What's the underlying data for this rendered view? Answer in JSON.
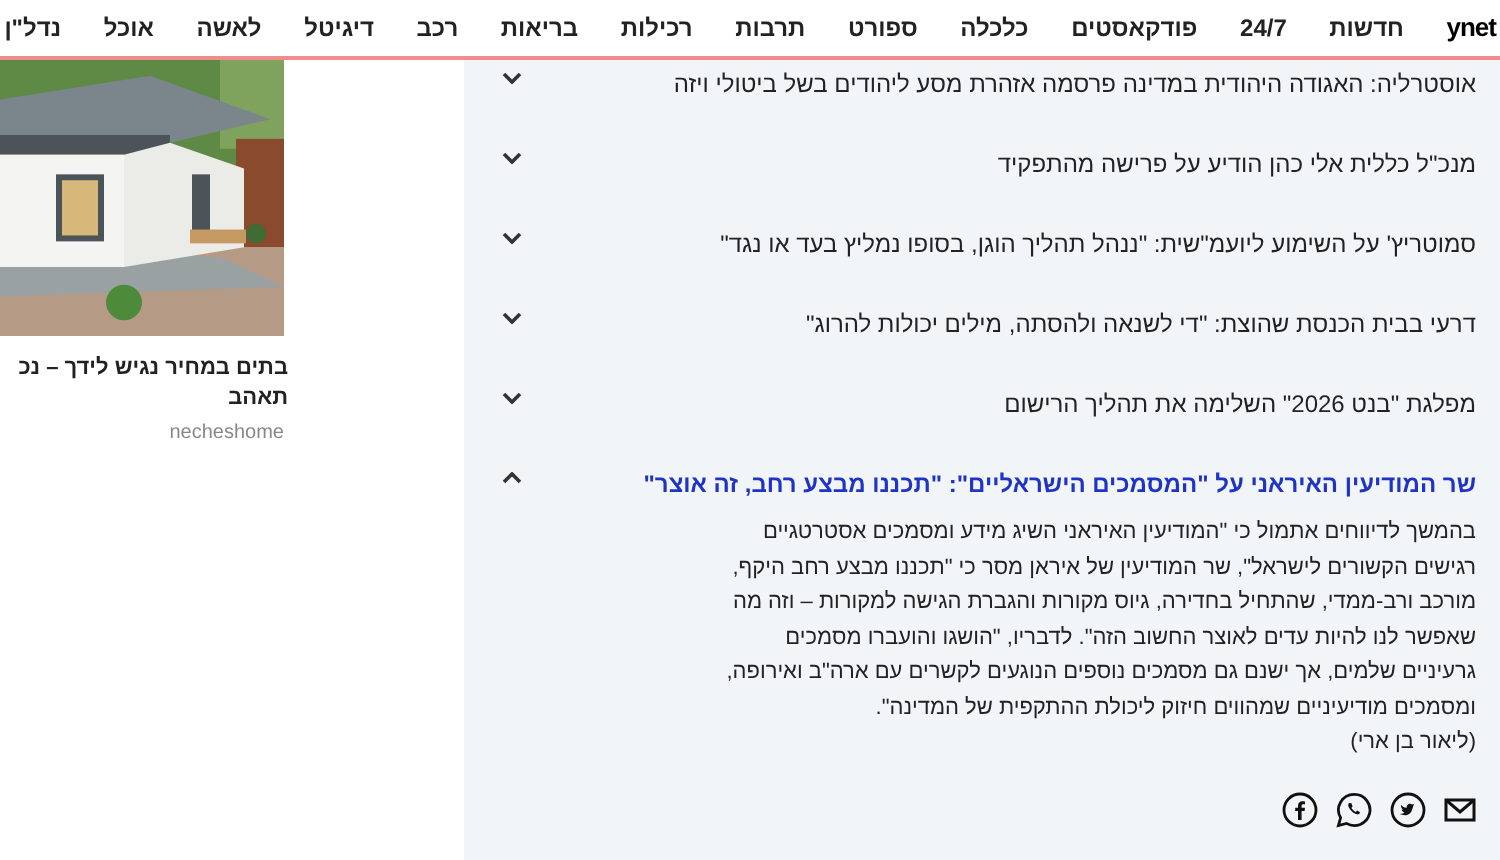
{
  "nav": {
    "items": [
      {
        "label": "ynet",
        "kind": "logo"
      },
      {
        "label": "חדשות"
      },
      {
        "label": "24/7"
      },
      {
        "label": "פודקאסטים"
      },
      {
        "label": "כלכלה"
      },
      {
        "label": "ספורט"
      },
      {
        "label": "תרבות"
      },
      {
        "label": "רכילות"
      },
      {
        "label": "בריאות"
      },
      {
        "label": "רכב"
      },
      {
        "label": "דיגיטל"
      },
      {
        "label": "לאשה"
      },
      {
        "label": "אוכל"
      },
      {
        "label": "נדל\"ן"
      }
    ]
  },
  "ad": {
    "title_lines": [
      "בתים במחיר נגיש לידך – נכ",
      "תאהב"
    ],
    "source": "necheshome"
  },
  "news": [
    {
      "headline": "אוסטרליה: האגודה היהודית במדינה פרסמה אזהרת מסע ליהודים בשל ביטולי ויזה",
      "expanded": false
    },
    {
      "headline": "מנכ\"ל כללית אלי כהן הודיע על פרישה מהתפקיד",
      "expanded": false
    },
    {
      "headline": "סמוטריץ' על השימוע ליועמ\"שית: \"ננהל תהליך הוגן, בסופו נמליץ בעד או נגד\"",
      "expanded": false
    },
    {
      "headline": "דרעי בבית הכנסת שהוצת: \"די לשנאה ולהסתה, מילים יכולות להרוג\"",
      "expanded": false
    },
    {
      "headline": "מפלגת \"בנט 2026\" השלימה את תהליך הרישום",
      "expanded": false
    },
    {
      "headline": "שר המודיעין האיראני על \"המסמכים הישראליים\": \"תכננו מבצע רחב, זה אוצר\"",
      "expanded": true,
      "body": "בהמשך לדיווחים אתמול כי \"המודיעין האיראני השיג מידע ומסמכים אסטרטגיים רגישים הקשורים לישראל\", שר המודיעין של איראן מסר כי \"תכננו מבצע רחב היקף, מורכב ורב-ממדי, שהתחיל בחדירה, גיוס מקורות והגברת הגישה למקורות – וזה מה שאפשר לנו להיות עדים לאוצר החשוב הזה\". לדבריו, \"הושגו והועברו מסמכים גרעיניים שלמים, אך ישנם גם מסמכים נוספים הנוגעים לקשרים עם ארה\"ב ואירופה, ומסמכים מודיעיניים שמהווים חיזוק ליכולת ההתקפית של המדינה\".",
      "byline": "(ליאור בן ארי)"
    }
  ]
}
